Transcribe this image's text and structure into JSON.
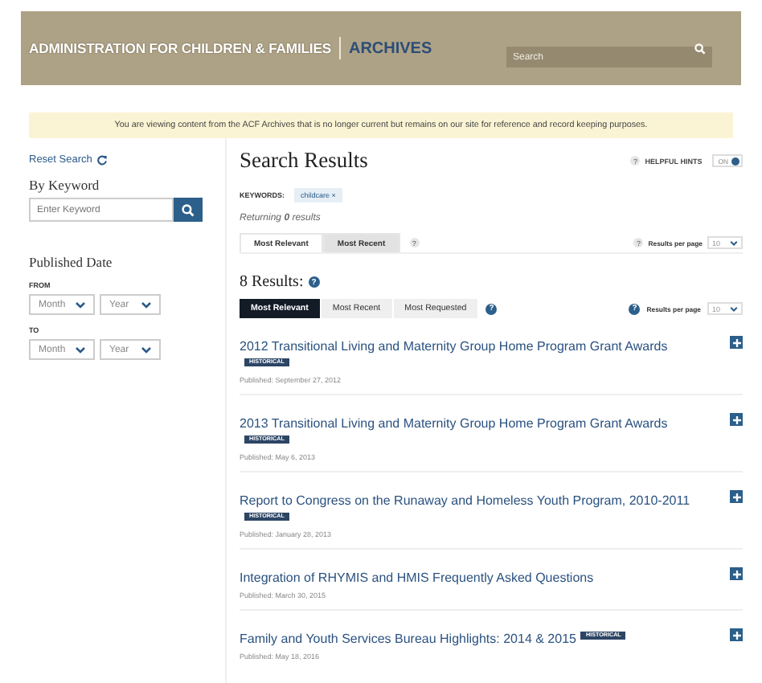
{
  "header": {
    "title": "ADMINISTRATION FOR CHILDREN & FAMILIES",
    "section": "ARCHIVES",
    "search": {
      "placeholder": "Search"
    }
  },
  "notice": "You are viewing content from the ACF Archives that is no longer current but remains on our site for reference and record keeping purposes.",
  "sidebar": {
    "reset": "Reset Search",
    "keyword_heading": "By Keyword",
    "keyword_field": {
      "placeholder": "Enter Keyword"
    },
    "date_heading": "Published Date",
    "ranges": [
      {
        "label": "FROM",
        "month": "Month",
        "year": "Year"
      },
      {
        "label": "TO",
        "month": "Month",
        "year": "Year"
      }
    ]
  },
  "main": {
    "title": "Search Results",
    "hints": {
      "help": "?",
      "label": "HELPFUL HINTS",
      "toggle": "ON",
      "on": true
    },
    "sort_help": "?",
    "per_page_help": "?",
    "count_help": "?",
    "result_tabs_help": "?",
    "results_per_page_help": "?",
    "keywords_label": "KEYWORDS:",
    "keywords": [
      {
        "text": "childcare",
        "remove": "×"
      }
    ],
    "returning": "Returning **0** results",
    "sort_tabs": [
      {
        "label": "Most Relevant",
        "selected": true
      },
      {
        "label": "Most Recent",
        "selected": false
      }
    ],
    "per_page_label": "Results per page",
    "per_page": "10",
    "count": "8 Results:",
    "result_tabs": [
      {
        "label": "Most Relevant",
        "selected": true
      },
      {
        "label": "Most Recent",
        "selected": false
      },
      {
        "label": "Most Requested",
        "selected": false
      }
    ],
    "results_per_page_label": "Results per page",
    "results_per_page": "10",
    "results": [
      {
        "title": "2012 Transitional Living and Maternity Group Home Program Grant Awards",
        "badge": "HISTORICAL",
        "published": "Published: September 27, 2012"
      },
      {
        "title": "2013 Transitional Living and Maternity Group Home Program Grant Awards",
        "badge": "HISTORICAL",
        "published": "Published: May 6, 2013"
      },
      {
        "title": "Report to Congress on the Runaway and Homeless Youth Program, 2010-2011",
        "badge": "HISTORICAL",
        "published": "Published: January 28, 2013"
      },
      {
        "title": "Integration of RHYMIS and HMIS Frequently Asked Questions",
        "published": "Published: March 30, 2015"
      },
      {
        "title": "Family and Youth Services Bureau Highlights: 2014 & 2015",
        "badge": "HISTORICAL",
        "published": "Published: May 18, 2016"
      }
    ]
  }
}
